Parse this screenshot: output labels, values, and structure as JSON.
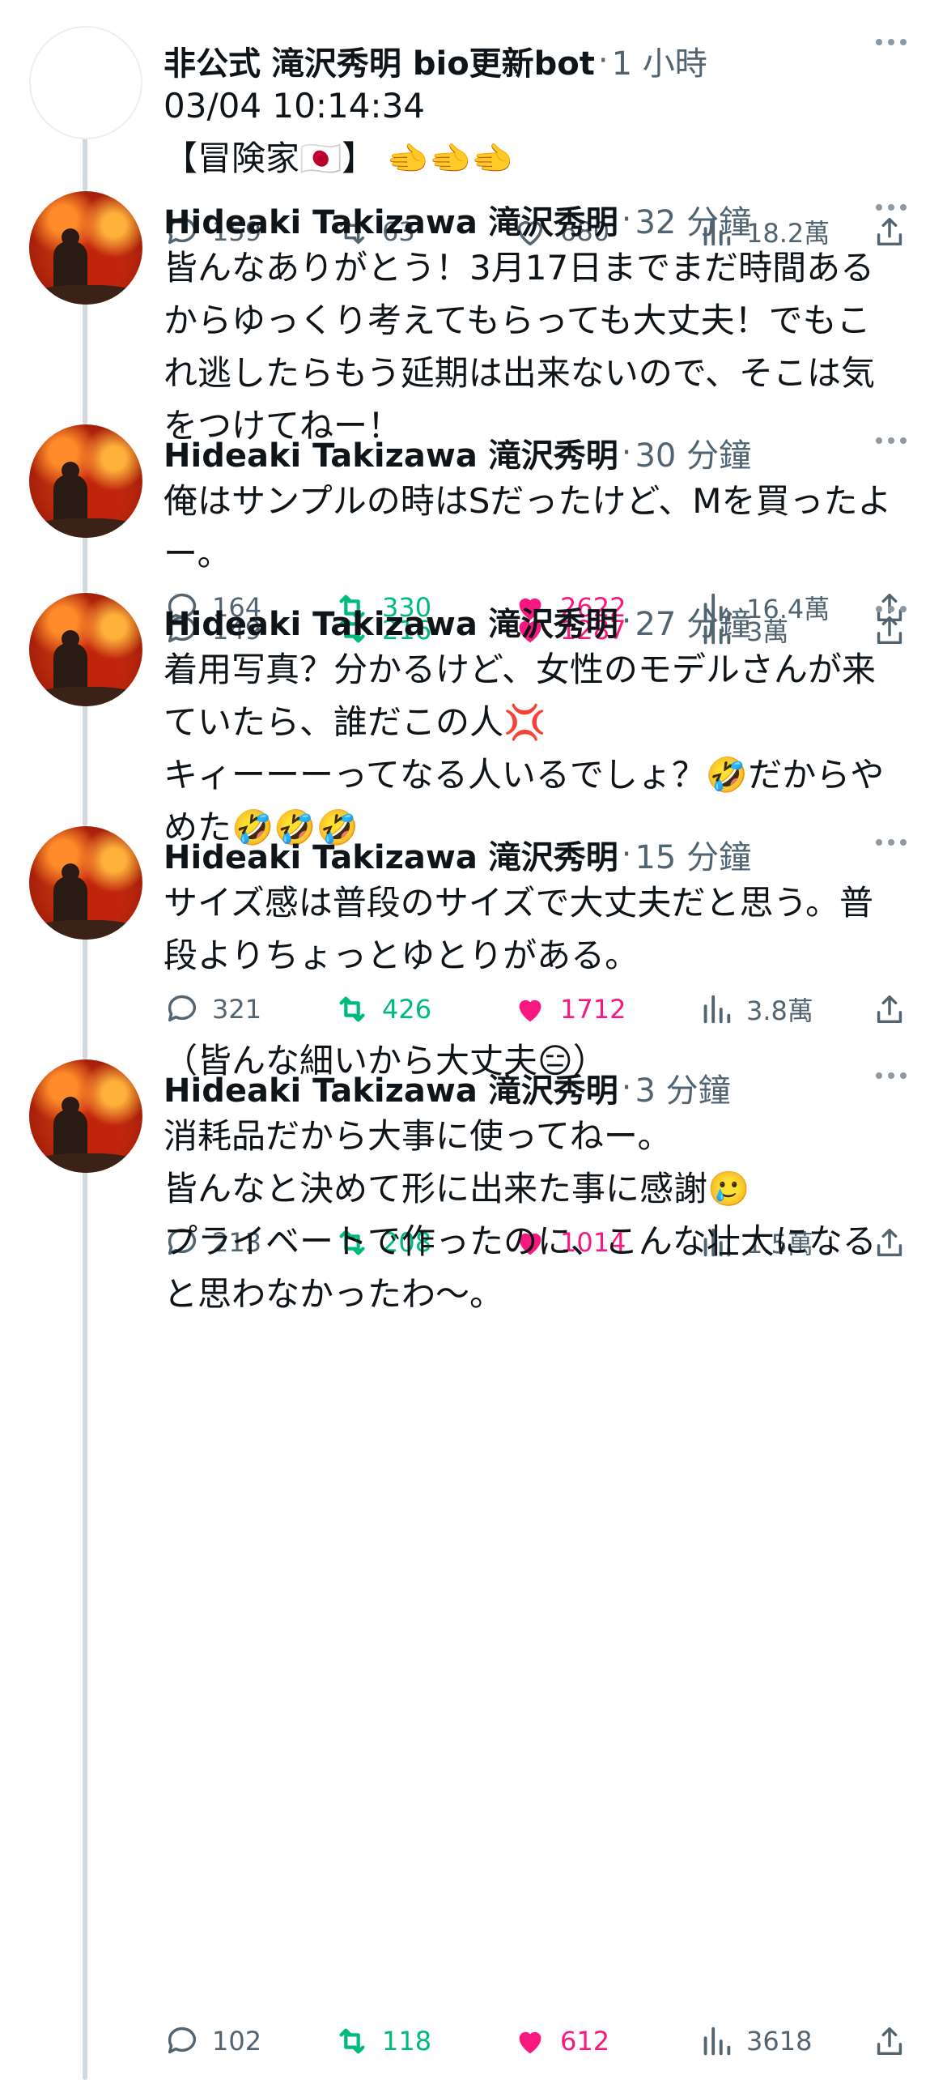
{
  "tweets": [
    {
      "name": "非公式 滝沢秀明 bio更新bot",
      "time": "1 小時",
      "avatar": "blank-avatar",
      "text": "03/04 10:14:34\n【冒険家🇯🇵】 🫲🫲🫲",
      "replies": "159",
      "retweets": "63",
      "likes": "680",
      "views": "18.2萬",
      "liked": false,
      "retweeted": false
    },
    {
      "name": "Hideaki Takizawa 滝沢秀明",
      "time": "32 分鐘",
      "avatar": "fire-avatar",
      "text": "皆んなありがとう！3月17日までまだ時間あるからゆっくり考えてもらっても大丈夫！でもこれ逃したらもう延期は出来ないので、そこは気をつけてねー！",
      "replies": "164",
      "retweets": "330",
      "likes": "2622",
      "views": "16.4萬",
      "liked": true,
      "retweeted": true
    },
    {
      "name": "Hideaki Takizawa 滝沢秀明",
      "time": "30 分鐘",
      "avatar": "fire-avatar",
      "text": "俺はサンプルの時はSだったけど、Mを買ったよー。",
      "replies": "149",
      "retweets": "216",
      "likes": "1287",
      "views": "3萬",
      "liked": true,
      "retweeted": true
    },
    {
      "name": "Hideaki Takizawa 滝沢秀明",
      "time": "27 分鐘",
      "avatar": "fire-avatar",
      "text": "着用写真？分かるけど、女性のモデルさんが来ていたら、誰だこの人💢\nキィーーーってなる人いるでしょ？🤣だからやめた🤣🤣🤣",
      "replies": "321",
      "retweets": "426",
      "likes": "1712",
      "views": "3.8萬",
      "liked": true,
      "retweeted": true
    },
    {
      "name": "Hideaki Takizawa 滝沢秀明",
      "time": "15 分鐘",
      "avatar": "fire-avatar",
      "text": "サイズ感は普段のサイズで大丈夫だと思う。普段よりちょっとゆとりがある。\n\n（皆んな細いから大丈夫😑）",
      "replies": "213",
      "retweets": "208",
      "likes": "1014",
      "views": "1.5萬",
      "liked": true,
      "retweeted": true
    },
    {
      "name": "Hideaki Takizawa 滝沢秀明",
      "time": "3 分鐘",
      "avatar": "fire-avatar",
      "text": "消耗品だから大事に使ってねー。\n皆んなと決めて形に出来た事に感謝🥲\nプライベートで作ったのに、こんな壮大になると思わなかったわ〜。",
      "replies": "102",
      "retweets": "118",
      "likes": "612",
      "views": "3618",
      "liked": true,
      "retweeted": true
    }
  ],
  "colors": {
    "text": "#0f1419",
    "muted": "#536471",
    "retweet_active": "#00ba7c",
    "like_active": "#f91880",
    "thread_line": "#cfd9de"
  },
  "icons": [
    "reply-icon",
    "retweet-icon",
    "like-icon",
    "views-icon",
    "share-icon",
    "more-icon"
  ]
}
